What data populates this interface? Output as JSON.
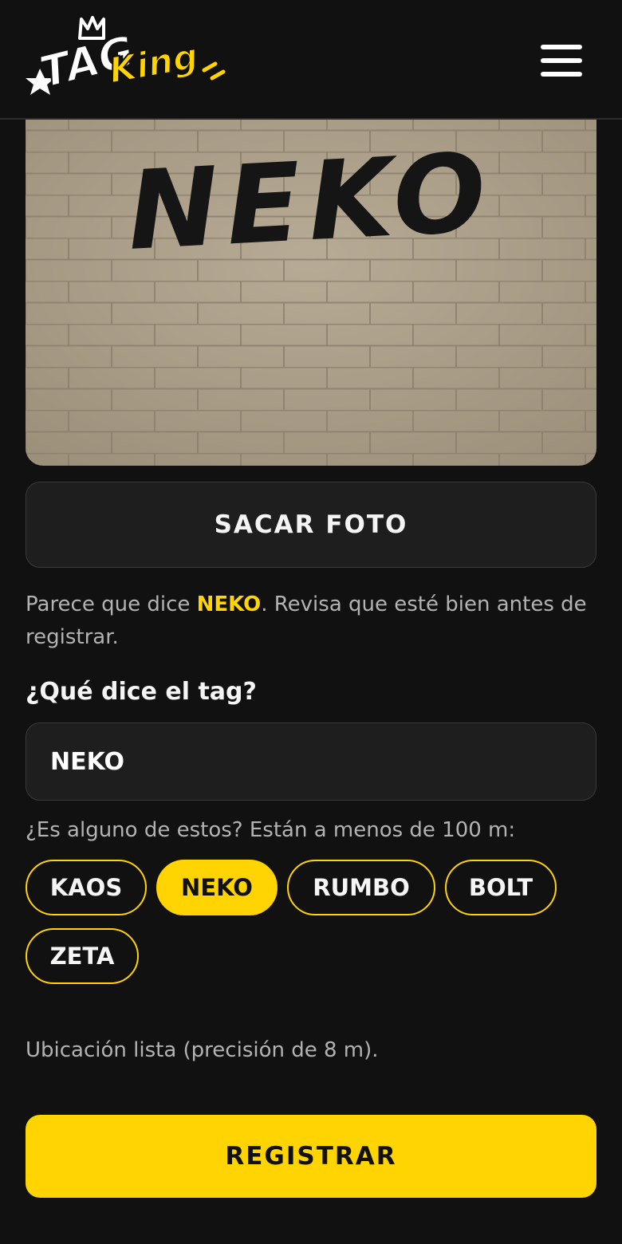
{
  "header": {
    "logo_text": "TagKing",
    "menu_icon": "hamburger-menu-icon",
    "accent_color": "#ffd400"
  },
  "photo": {
    "tag_text": "NEKO"
  },
  "actions": {
    "take_photo_label": "SACAR FOTO",
    "register_label": "REGISTRAR"
  },
  "detection": {
    "prefix": "Parece que dice ",
    "detected": "NEKO",
    "suffix": ". Revisa que esté bien antes de registrar."
  },
  "form": {
    "question_label": "¿Qué dice el tag?",
    "tag_value": "NEKO"
  },
  "nearby": {
    "label": "¿Es alguno de estos? Están a menos de 100 m:",
    "tags": [
      {
        "label": "KAOS",
        "selected": false
      },
      {
        "label": "NEKO",
        "selected": true
      },
      {
        "label": "RUMBO",
        "selected": false
      },
      {
        "label": "BOLT",
        "selected": false
      },
      {
        "label": "ZETA",
        "selected": false
      }
    ]
  },
  "location": {
    "status": "Ubicación lista (precisión de 8 m)."
  }
}
